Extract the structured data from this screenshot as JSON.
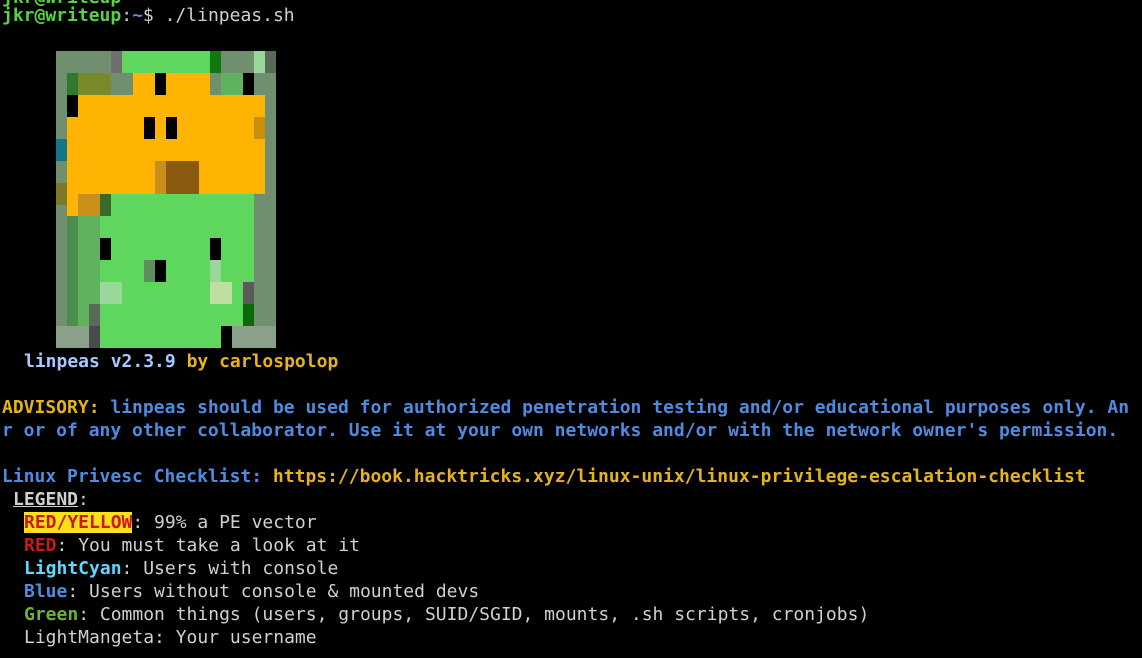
{
  "colors": {
    "background": "#000000",
    "default_text": "#d0d0d0",
    "prompt_green": "#55d43c",
    "prompt_blue": "#4f8be0",
    "advisory_yellow": "#e5b31c",
    "advisory_blue": "#4f8be0",
    "red": "#cc1818",
    "highlight_yellow": "#ffe11a",
    "light_cyan": "#5fd7ff",
    "green": "#6bb33a",
    "art_orange": "#ffb302",
    "art_green": "#5fd75f"
  },
  "prompt": {
    "user_host": "jkr@writeup",
    "separator": ":",
    "path": "~",
    "symbol": "$ ",
    "command": "./linpeas.sh"
  },
  "banner": {
    "name": "linpeas v2.3.9",
    "by": "by carlospolop"
  },
  "advisory": {
    "label": "ADVISORY:",
    "line1": " linpeas should be used for authorized penetration testing and/or educational purposes only. An",
    "line2": "r or of any other collaborator. Use it at your own networks and/or with the network owner's permission."
  },
  "checklist": {
    "label": "Linux Privesc Checklist:",
    "url": " https://book.hacktricks.xyz/linux-unix/linux-privilege-escalation-checklist"
  },
  "legend": {
    "title": "LEGEND",
    "colon": ":",
    "items": [
      {
        "key": "RED/YELLOW",
        "desc": ": 99% a PE vector"
      },
      {
        "key": "RED",
        "desc": ": You must take a look at it"
      },
      {
        "key": "LightCyan",
        "desc": ": Users with console"
      },
      {
        "key": "Blue",
        "desc": ": Users without console & mounted devs"
      },
      {
        "key": "Green",
        "desc": ": Common things (users, groups, SUID/SGID, mounts, .sh scripts, cronjobs)"
      },
      {
        "key": "LightMangeta",
        "desc": ": Your username"
      }
    ]
  }
}
